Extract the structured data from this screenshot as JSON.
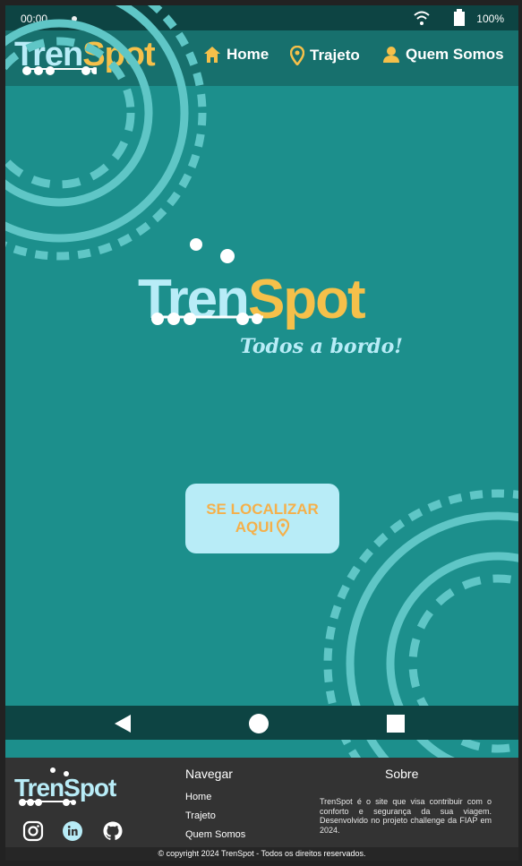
{
  "status_bar": {
    "time": "00:00",
    "battery": "100%"
  },
  "header": {
    "logo_part1": "Tren",
    "logo_part2": "Spot",
    "nav": [
      {
        "label": "Home",
        "icon": "home-icon"
      },
      {
        "label": "Trajeto",
        "icon": "location-pin-icon"
      },
      {
        "label": "Quem Somos",
        "icon": "person-icon"
      }
    ]
  },
  "hero": {
    "logo_part1": "Tren",
    "logo_part2": "Spot",
    "tagline": "Todos a bordo!",
    "cta_line1": "SE LOCALIZAR",
    "cta_line2": "AQUI"
  },
  "footer": {
    "logo_part1": "Tren",
    "logo_part2": "Spot",
    "navegar_title": "Navegar",
    "links": [
      "Home",
      "Trajeto",
      "Quem Somos"
    ],
    "sobre_title": "Sobre",
    "sobre_text": "TrenSpot é o site que visa contribuir com o conforto e segurança da sua viagem. Desenvolvido no projeto challenge da FIAP em 2024.",
    "social_icons": [
      "instagram-icon",
      "linkedin-icon",
      "github-icon"
    ],
    "copyright": "© copyright 2024 TrenSpot - Todos os direitos reservados."
  },
  "colors": {
    "teal": "#1c8f8c",
    "dark_teal": "#0d4443",
    "light_blue": "#b8ecf7",
    "yellow": "#f5c04a",
    "footer_bg": "#333333"
  }
}
